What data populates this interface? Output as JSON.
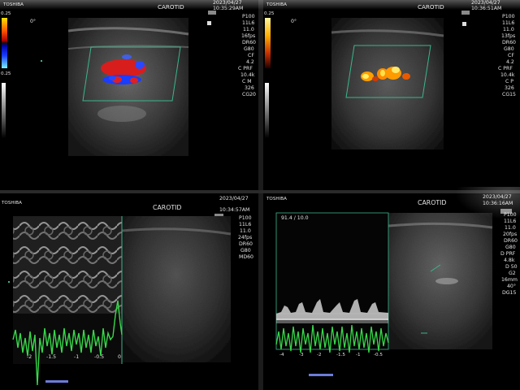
{
  "panels": [
    {
      "id": "top-left",
      "brand": "TOSHIBA",
      "exam": "CAROTID",
      "date": "2023/04/27",
      "time": "10:35:29AM",
      "orientation": "0°",
      "scale_top": "0.25",
      "scale_bottom": "0.25",
      "params": [
        "P100",
        "11L6",
        "11.0",
        "16fps",
        "DR60",
        "G80",
        "CF",
        "4.2",
        "C PRF",
        "10.4k",
        "C M",
        "326",
        "CG20"
      ],
      "mode": "color-doppler"
    },
    {
      "id": "top-right",
      "brand": "TOSHIBA",
      "exam": "CAROTID",
      "date": "2023/04/27",
      "time": "10:36:51AM",
      "orientation": "0°",
      "scale_top": "0.25",
      "params": [
        "P100",
        "11L6",
        "11.0",
        "13fps",
        "DR60",
        "G80",
        "CF",
        "4.2",
        "C PRF",
        "10.4k",
        "C P",
        "326",
        "CG15"
      ],
      "mode": "power-doppler"
    },
    {
      "id": "bottom-left",
      "brand": "TOSHIBA",
      "exam": "CAROTID",
      "date": "2023/04/27",
      "time": "10:34:57AM",
      "params": [
        "P100",
        "11L6",
        "11.0",
        "24fps",
        "DR60",
        "G80",
        "MD60"
      ],
      "axis_ticks": [
        "-2",
        "-1.5",
        "-1",
        "-0.5",
        "0"
      ],
      "mode": "m-mode"
    },
    {
      "id": "bottom-right",
      "brand": "TOSHIBA",
      "exam": "CAROTID",
      "date": "2023/04/27",
      "time": "10:36:16AM",
      "readout": "91.4 / 10.0",
      "params": [
        "P100",
        "11L6",
        "11.0",
        "20fps",
        "DR60",
        "G80",
        "D PRF",
        "4.8k",
        "D 50",
        "G2",
        "16mm",
        "40°",
        "DG15"
      ],
      "axis_ticks": [
        "-4",
        "-3",
        "-2",
        "-1.5",
        "-1",
        "-0.5"
      ],
      "mode": "spectral-doppler"
    }
  ],
  "colors": {
    "monitor_black": "#000000",
    "bezel": "#0c0c0c",
    "doppler_red": "#e02020",
    "doppler_blue": "#1a3dff",
    "power_orange": "#ffb000",
    "trace_green": "#38d84a",
    "roi_green": "#3bb58c"
  }
}
